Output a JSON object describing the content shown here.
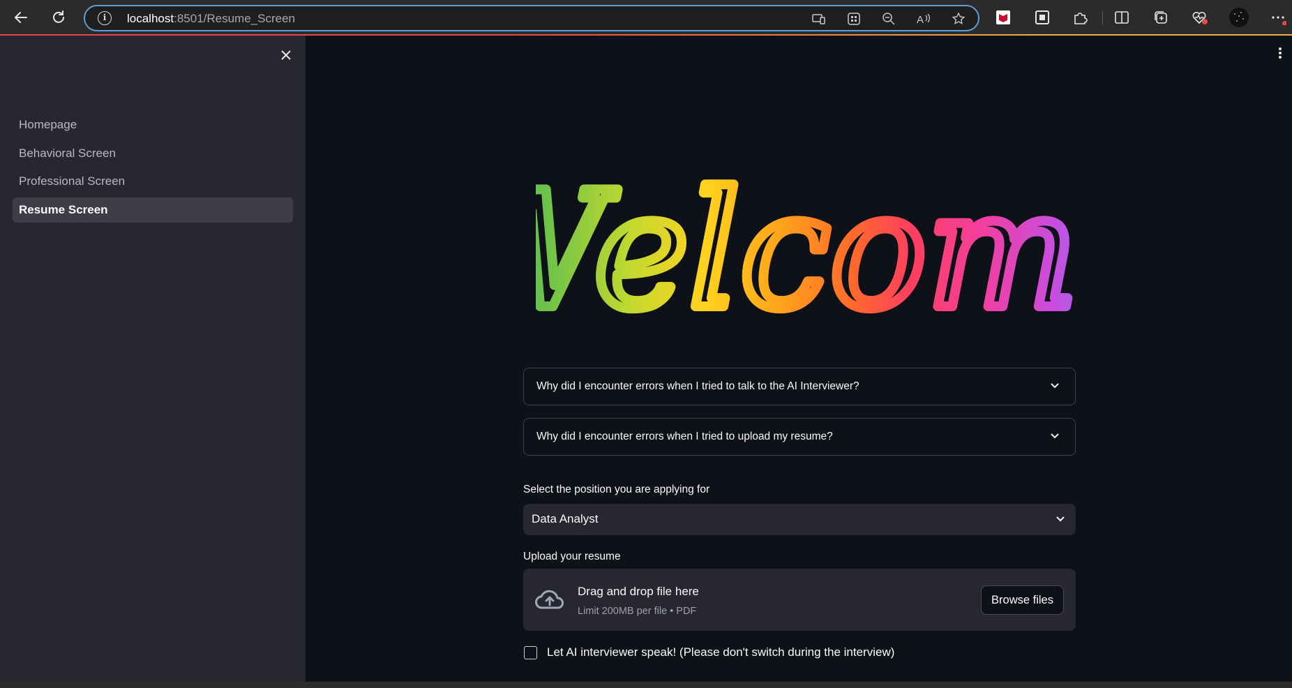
{
  "browser": {
    "url_host": "localhost",
    "url_rest": ":8501/Resume_Screen",
    "back_icon": "back-arrow-icon",
    "reload_icon": "reload-icon"
  },
  "sidebar": {
    "items": [
      {
        "label": "Homepage"
      },
      {
        "label": "Behavioral Screen"
      },
      {
        "label": "Professional Screen"
      },
      {
        "label": "Resume Screen",
        "active": true
      }
    ]
  },
  "main": {
    "welcome_text": "Welcome",
    "faq": [
      {
        "question": "Why did I encounter errors when I tried to talk to the AI Interviewer?"
      },
      {
        "question": "Why did I encounter errors when I tried to upload my resume?"
      }
    ],
    "position_label": "Select the position you are applying for",
    "position_value": "Data Analyst",
    "upload_label": "Upload your resume",
    "upload_title": "Drag and drop file here",
    "upload_limit": "Limit 200MB per file • PDF",
    "browse_label": "Browse files",
    "speak_label": "Let AI interviewer speak! (Please don't switch during the interview)",
    "speak_checked": false
  },
  "colors": {
    "sidebar_bg": "#262730",
    "main_bg": "#0e1117",
    "accent": "#ff4b4b"
  }
}
